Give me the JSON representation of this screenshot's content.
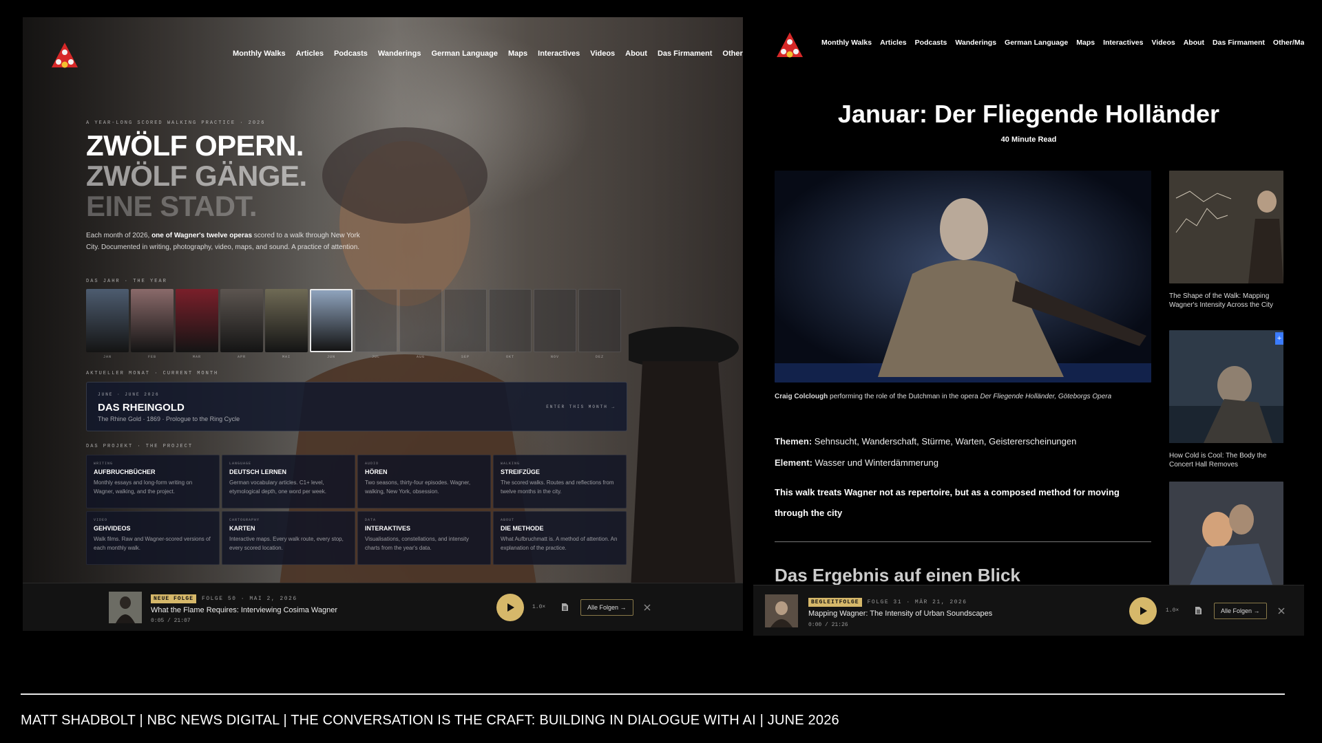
{
  "nav": [
    "Monthly Walks",
    "Articles",
    "Podcasts",
    "Wanderings",
    "German Language",
    "Maps",
    "Interactives",
    "Videos",
    "About",
    "Das Firmament",
    "Other/Matts"
  ],
  "left": {
    "kicker": "A YEAR-LONG SCORED WALKING PRACTICE · 2026",
    "heading": [
      "ZWÖLF OPERN.",
      "ZWÖLF GÄNGE.",
      "EINE STADT."
    ],
    "lead_pre": "Each month of 2026, ",
    "lead_bold": "one of Wagner's twelve operas",
    "lead_post": " scored to a walk through New York City. Documented in writing, photography, video, maps, and sound. A practice of attention.",
    "year_label": "DAS JAHR · THE YEAR",
    "months": [
      "JAN",
      "FEB",
      "MAR",
      "APR",
      "MAI",
      "JUN",
      "JUL",
      "AUG",
      "SEP",
      "OKT",
      "NOV",
      "DEZ"
    ],
    "current_label": "AKTUELLER MONAT · CURRENT MONTH",
    "current": {
      "dates": "JUNE · JUNE 2026",
      "title": "DAS RHEINGOLD",
      "subtitle": "The Rhine Gold · 1869 · Prologue to the Ring Cycle",
      "cta": "ENTER THIS MONTH →"
    },
    "project_label": "DAS PROJEKT · THE PROJECT",
    "cards": [
      {
        "kicker": "WRITING",
        "title": "AUFBRUCHBÜCHER",
        "desc": "Monthly essays and long-form writing on Wagner, walking, and the project."
      },
      {
        "kicker": "LANGUAGE",
        "title": "DEUTSCH LERNEN",
        "desc": "German vocabulary articles. C1+ level, etymological depth, one word per week."
      },
      {
        "kicker": "AUDIO",
        "title": "HÖREN",
        "desc": "Two seasons, thirty-four episodes. Wagner, walking, New York, obsession."
      },
      {
        "kicker": "WALKING",
        "title": "STREIFZÜGE",
        "desc": "The scored walks. Routes and reflections from twelve months in the city."
      },
      {
        "kicker": "VIDEO",
        "title": "GEHVIDEOS",
        "desc": "Walk films. Raw and Wagner-scored versions of each monthly walk."
      },
      {
        "kicker": "CARTOGRAPHY",
        "title": "KARTEN",
        "desc": "Interactive maps. Every walk route, every stop, every scored location."
      },
      {
        "kicker": "DATA",
        "title": "INTERAKTIVES",
        "desc": "Visualisations, constellations, and intensity charts from the year's data."
      },
      {
        "kicker": "ABOUT",
        "title": "DIE METHODE",
        "desc": "What Aufbruchmatt is. A method of attention. An explanation of the practice."
      }
    ],
    "player": {
      "badge": "NEUE FOLGE",
      "meta": "FOLGE 50 · MAI 2, 2026",
      "title": "What the Flame Requires: Interviewing Cosima Wagner",
      "time": "0:05  /  21:07",
      "speed": "1.0×",
      "all": "Alle Folgen →"
    }
  },
  "right": {
    "title": "Januar: Der Fliegende Holländer",
    "read": "40 Minute Read",
    "caption_name": "Craig Colclough",
    "caption_mid": " performing the role of the Dutchman in the opera ",
    "caption_italic": "Der Fliegende Holländer, Göteborgs Opera",
    "themes_label": "Themen:",
    "themes": " Sehnsucht, Wanderschaft, Stürme, Warten, Geistererscheinungen",
    "element_label": "Element:",
    "element": " Wasser und Winterdämmerung",
    "statement": "This walk treats Wagner not as repertoire, but as a composed method for moving through the city",
    "section": "Das Ergebnis auf einen Blick",
    "side": [
      {
        "caption": "The Shape of the Walk: Mapping Wagner's Intensity Across the City"
      },
      {
        "caption": "How Cold is Cool: The Body the Concert Hall Removes"
      }
    ],
    "plus": "+",
    "player": {
      "badge": "BEGLEITFOLGE",
      "meta": "FOLGE 31 · MÄR 21, 2026",
      "title": "Mapping Wagner: The Intensity of Urban Soundscapes",
      "time": "0:00  /  21:26",
      "speed": "1.0×",
      "all": "Alle Folgen →"
    }
  },
  "footer": "MATT SHADBOLT | NBC NEWS DIGITAL | THE CONVERSATION IS THE CRAFT: BUILDING IN DIALOGUE WITH AI | JUNE 2026",
  "colors": {
    "accent": "#d6b86a",
    "logo_red": "#d62828",
    "logo_yellow": "#f2c230"
  }
}
